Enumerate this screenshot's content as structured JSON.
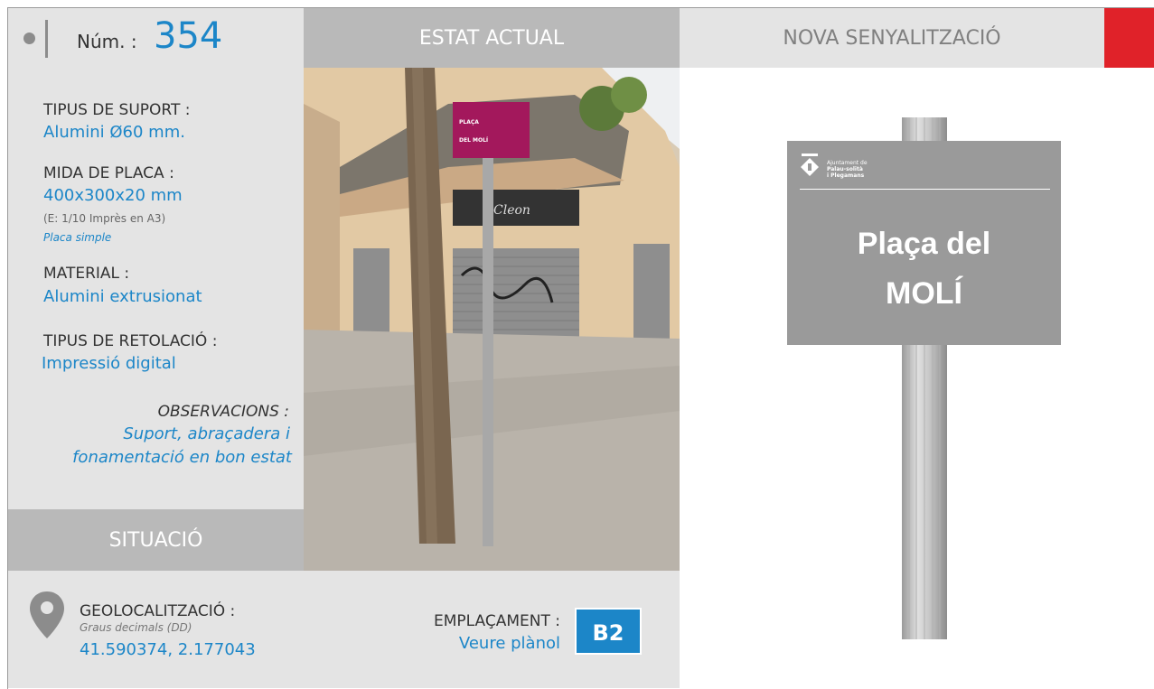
{
  "header": {
    "num_label": "Núm. :",
    "num_value": "354",
    "estat_actual": "ESTAT ACTUAL",
    "nova_senyalitzacio": "NOVA SENYALITZACIÓ",
    "accent_color": "#e02229"
  },
  "details": {
    "tipus_suport_label": "TIPUS DE SUPORT :",
    "tipus_suport_value": "Alumini Ø60 mm.",
    "mida_placa_label": "MIDA DE PLACA :",
    "mida_placa_value": "400x300x20 mm",
    "mida_placa_scale": "(E: 1/10 Imprès en A3)",
    "mida_placa_type": "Placa simple",
    "material_label": "MATERIAL :",
    "material_value": "Alumini extrusionat",
    "retolacio_label": "TIPUS DE RETOLACIÓ :",
    "retolacio_value": "Impressió digital",
    "observacions_label": "OBSERVACIONS :",
    "observacions_line1": "Suport, abraçadera i",
    "observacions_line2": "fonamentació en bon estat"
  },
  "situacio": {
    "label": "SITUACIÓ",
    "geo_label": "GEOLOCALITZACIÓ :",
    "geo_format": "Graus decimals (DD)",
    "geo_value": "41.590374, 2.177043",
    "emplacament_label": "EMPLAÇAMENT :",
    "emplacament_link": "Veure plànol",
    "emplacament_code": "B2",
    "pin_icon": "map-pin-icon"
  },
  "photo": {
    "sign_line1": "PLAÇA",
    "sign_line2": "DEL MOLÍ",
    "shop_text": "Cleon"
  },
  "new_sign": {
    "muni_line1": "Ajuntament de",
    "muni_line2": "Palau-solità",
    "muni_line3": "i Plegamans",
    "title_line1": "Plaça del",
    "title_line2": "MOLÍ",
    "plate_color": "#9a9a9a"
  }
}
